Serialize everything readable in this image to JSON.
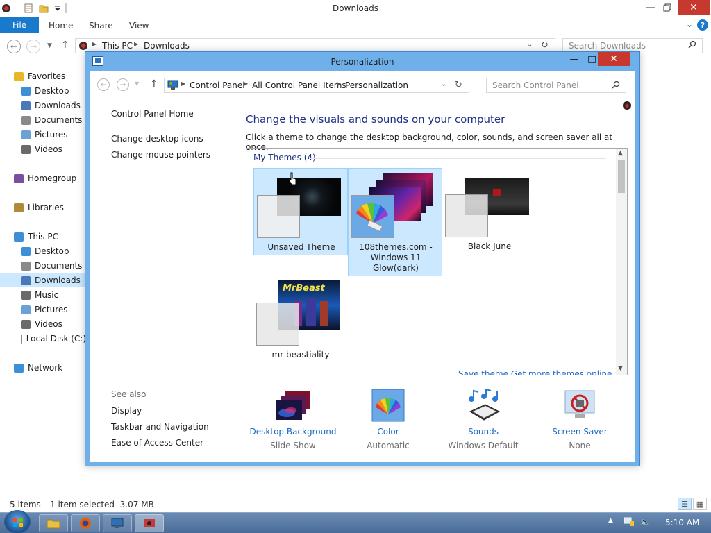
{
  "explorer": {
    "title": "Downloads",
    "ribbon_tabs": [
      "File",
      "Home",
      "Share",
      "View"
    ],
    "address": {
      "segments": [
        "This PC",
        "Downloads"
      ]
    },
    "search_placeholder": "Search Downloads",
    "sidebar": [
      {
        "label": "Favorites",
        "icon": "star-icon",
        "color": "#e8b626"
      },
      {
        "label": "Desktop",
        "icon": "desktop-icon",
        "color": "#3d8fd6"
      },
      {
        "label": "Downloads",
        "icon": "downloads-icon",
        "color": "#4a78b8"
      },
      {
        "label": "Documents",
        "icon": "documents-icon",
        "color": "#8a8a8a"
      },
      {
        "label": "Pictures",
        "icon": "pictures-icon",
        "color": "#6aa2d8"
      },
      {
        "label": "Videos",
        "icon": "videos-icon",
        "color": "#6a6a6a"
      },
      {
        "label": "Homegroup",
        "icon": "homegroup-icon",
        "color": "#7a4fa0"
      },
      {
        "label": "Libraries",
        "icon": "libraries-icon",
        "color": "#b08a3a"
      },
      {
        "label": "This PC",
        "icon": "computer-icon",
        "color": "#3d8fd6"
      },
      {
        "label": "Desktop",
        "icon": "desktop-icon",
        "color": "#3d8fd6"
      },
      {
        "label": "Documents",
        "icon": "documents-icon",
        "color": "#8a8a8a"
      },
      {
        "label": "Downloads",
        "icon": "downloads-icon",
        "color": "#4a78b8"
      },
      {
        "label": "Music",
        "icon": "music-icon",
        "color": "#6a6a6a"
      },
      {
        "label": "Pictures",
        "icon": "pictures-icon",
        "color": "#6aa2d8"
      },
      {
        "label": "Videos",
        "icon": "videos-icon",
        "color": "#6a6a6a"
      },
      {
        "label": "Local Disk (C:)",
        "icon": "drive-icon",
        "color": "#8a8a8a"
      },
      {
        "label": "Network",
        "icon": "network-icon",
        "color": "#3d8fd6"
      }
    ],
    "status": {
      "items": "5 items",
      "selected": "1 item selected  3.07 MB"
    }
  },
  "personalization": {
    "title": "Personalization",
    "breadcrumb": [
      "Control Panel",
      "All Control Panel Items",
      "Personalization"
    ],
    "search_placeholder": "Search Control Panel",
    "left_links": [
      "Control Panel Home",
      "Change desktop icons",
      "Change mouse pointers"
    ],
    "see_also_label": "See also",
    "see_also_links": [
      "Display",
      "Taskbar and Navigation",
      "Ease of Access Center"
    ],
    "heading": "Change the visuals and sounds on your computer",
    "instruction": "Click a theme to change the desktop background, color, sounds, and screen saver all at once.",
    "group_label": "My Themes (4)",
    "themes": [
      {
        "name": "Unsaved Theme",
        "selected": true
      },
      {
        "name": "108themes.com - Windows 11 Glow(dark)",
        "selected": true
      },
      {
        "name": "Black June",
        "selected": false
      },
      {
        "name": "mr beastiality",
        "selected": false
      }
    ],
    "thumb_logo_text": "MrBeast",
    "partial_links": "Save theme      Get more themes online",
    "bottom_items": [
      {
        "label": "Desktop Background",
        "sub": "Slide Show",
        "icon": "desktop-background-icon"
      },
      {
        "label": "Color",
        "sub": "Automatic",
        "icon": "color-icon"
      },
      {
        "label": "Sounds",
        "sub": "Windows Default",
        "icon": "sounds-icon"
      },
      {
        "label": "Screen Saver",
        "sub": "None",
        "icon": "screen-saver-icon"
      }
    ]
  },
  "taskbar": {
    "clock": "5:10 AM"
  }
}
